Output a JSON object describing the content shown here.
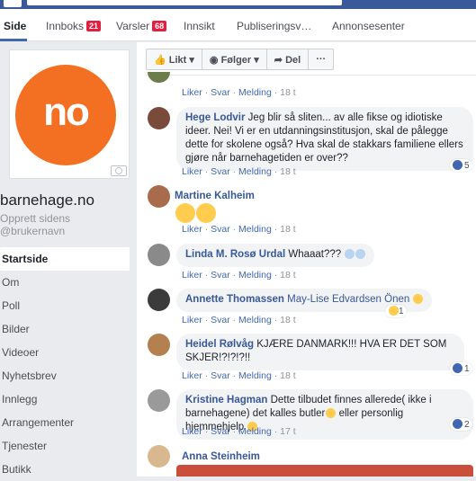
{
  "nav": {
    "tabs": [
      {
        "label": "Side"
      },
      {
        "label": "Innboks",
        "badge": "21"
      },
      {
        "label": "Varsler",
        "badge": "68"
      },
      {
        "label": "Innsikt"
      },
      {
        "label": "Publiseringsv…"
      },
      {
        "label": "Annonsesenter"
      }
    ]
  },
  "profile": {
    "logo_text": "no",
    "name": "barnehage.no",
    "line1": "Opprett sidens",
    "line2": "@brukernavn"
  },
  "sidebar": {
    "items": [
      {
        "label": "Startside"
      },
      {
        "label": "Om"
      },
      {
        "label": "Poll"
      },
      {
        "label": "Bilder"
      },
      {
        "label": "Videoer"
      },
      {
        "label": "Nyhetsbrev"
      },
      {
        "label": "Innlegg"
      },
      {
        "label": "Arrangementer"
      },
      {
        "label": "Tjenester"
      },
      {
        "label": "Butikk"
      }
    ]
  },
  "actions": {
    "like": "Likt ▾",
    "follow": "Følger ▾",
    "share": "Del",
    "more": "···"
  },
  "meta_labels": {
    "like": "Liker",
    "reply": "Svar",
    "message": "Melding",
    "sep": "·"
  },
  "comments": [
    {
      "author": "",
      "text": "",
      "time": "18 t"
    },
    {
      "author": "Hege Lodvir",
      "text": "Jeg blir så sliten... av alle fikse og idiotiske ideer. Nei! Vi er en utdanningsinstitusjon, skal de pålegge dette for skolene også? Hva skal de stakkars familiene ellers gjøre når barnehagetiden er over??",
      "time": "18 t",
      "reactions": "5"
    },
    {
      "author": "Martine Kalheim",
      "text": "",
      "time": "18 t"
    },
    {
      "author": "Linda M. Rosø Urdal",
      "text": "Whaaat???",
      "time": "18 t"
    },
    {
      "author": "Annette Thomassen",
      "text": "May-Lise Edvardsen Önen",
      "time": "18 t",
      "reactions": "1"
    },
    {
      "author": "Heidel Rølvåg",
      "text": "KJÆRE DANMARK!!! HVA ER DET SOM SKJER!?!?!?!!",
      "time": "18 t",
      "reactions": "1"
    },
    {
      "author": "Kristine Hagman",
      "text": "Dette tilbudet finnes allerede( ikke i barnehagene) det kalles butler",
      "text2": "eller personlig hjemmehjelp",
      "time": "17 t",
      "reactions": "2"
    },
    {
      "author": "Anna Steinheim",
      "text": "",
      "time": ""
    }
  ],
  "colors": {
    "brand": "#3b5998",
    "link": "#385898",
    "logo": "#f36f21"
  }
}
